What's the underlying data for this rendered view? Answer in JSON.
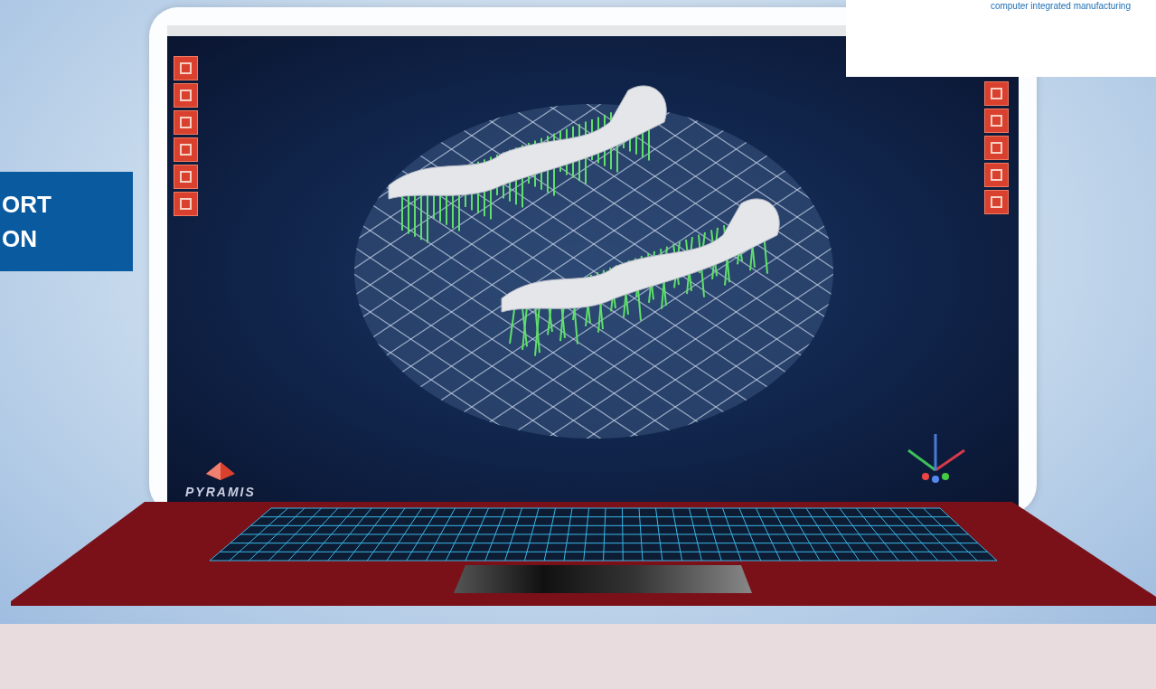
{
  "banner": {
    "lines": [
      "ORT",
      "ON"
    ]
  },
  "logo_box": {
    "tagline": "computer integrated manufacturing"
  },
  "app": {
    "brand": "PYRAMIS"
  }
}
